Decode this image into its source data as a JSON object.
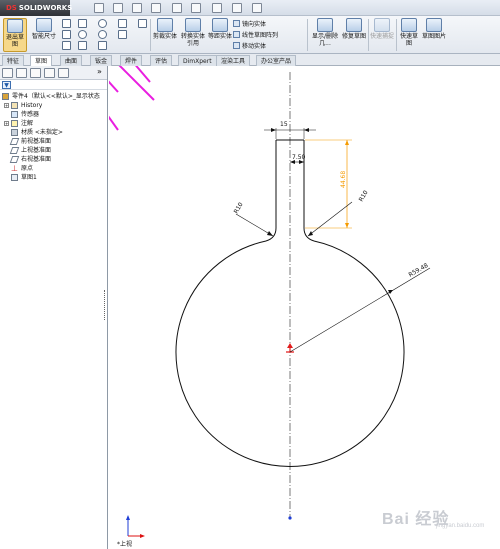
{
  "app": {
    "logo_text": "SOLIDWORKS",
    "logo_mark": "DS"
  },
  "quick_access": [
    "new-icon",
    "open-icon",
    "save-icon",
    "print-icon",
    "undo-icon",
    "redo-icon",
    "select-icon",
    "rebuild-icon",
    "options-icon"
  ],
  "command_manager": {
    "sketch_button": "退出草图",
    "smart_dimension": "智能尺寸",
    "trim_entities": "剪裁实体",
    "convert_entities": "转换实体引用",
    "offset_entities": "等距实体",
    "mirror_entities": "镜向实体",
    "linear_pattern": "线性草图阵列",
    "move_entities": "移动实体",
    "display_relations": "显示/删除几...",
    "repair_sketch": "修复草图",
    "quick_snaps": "快速捕捉",
    "rapid_sketch": "快速草图",
    "sketch_picture": "草图图片"
  },
  "tabs": [
    "特征",
    "草图",
    "曲面",
    "钣金",
    "焊件",
    "评估",
    "DimXpert",
    "渲染工具",
    "办公室产品"
  ],
  "active_tab_index": 1,
  "feature_tree": {
    "root": "零件4（默认<<默认>_显示状态",
    "items": [
      {
        "label": "History",
        "icon": "history-icon",
        "expandable": true
      },
      {
        "label": "传感器",
        "icon": "sensor-icon",
        "expandable": false
      },
      {
        "label": "注解",
        "icon": "annotation-icon",
        "expandable": true
      },
      {
        "label": "材质 <未指定>",
        "icon": "material-icon",
        "expandable": false
      },
      {
        "label": "前视基准面",
        "icon": "plane-icon",
        "expandable": false
      },
      {
        "label": "上视基准面",
        "icon": "plane-icon",
        "expandable": false
      },
      {
        "label": "右视基准面",
        "icon": "plane-icon",
        "expandable": false
      },
      {
        "label": "原点",
        "icon": "origin-icon",
        "expandable": false
      },
      {
        "label": "草图1",
        "icon": "sketch-icon",
        "expandable": false
      }
    ]
  },
  "sketch": {
    "dim_top_width": "15",
    "dim_half_width": "7.50",
    "dim_neck_height": "44.68",
    "dim_fillet_left": "R10",
    "dim_fillet_right": "R10",
    "dim_circle_radius": "R59.48"
  },
  "view_label": "*上视",
  "watermark": {
    "text": "Bai 经验",
    "sub": "jingyan.baidu.com"
  },
  "colors": {
    "annotation_arrow": "#e91ee0",
    "dimension": "#f59b00",
    "geometry": "#111111",
    "origin": "#e11d1d",
    "selected_tab": "#ffffff"
  }
}
